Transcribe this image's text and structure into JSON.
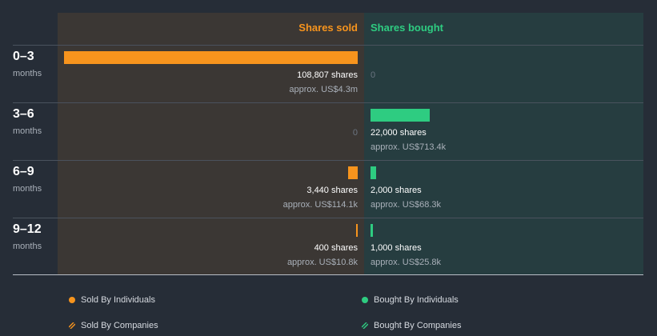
{
  "chart_data": {
    "type": "bar",
    "orientation": "horizontal",
    "columns": [
      "Shares sold",
      "Shares bought"
    ],
    "categories": [
      {
        "label": "0–3",
        "unit": "months"
      },
      {
        "label": "3–6",
        "unit": "months"
      },
      {
        "label": "6–9",
        "unit": "months"
      },
      {
        "label": "9–12",
        "unit": "months"
      }
    ],
    "series": [
      {
        "name": "Shares sold",
        "color": "#f7941d",
        "values": [
          108807,
          0,
          3440,
          400
        ],
        "share_labels": [
          "108,807 shares",
          "0",
          "3,440 shares",
          "400 shares"
        ],
        "approx_labels": [
          "approx. US$4.3m",
          "",
          "approx. US$114.1k",
          "approx. US$10.8k"
        ]
      },
      {
        "name": "Shares bought",
        "color": "#2ecc81",
        "values": [
          0,
          22000,
          2000,
          1000
        ],
        "share_labels": [
          "0",
          "22,000 shares",
          "2,000 shares",
          "1,000 shares"
        ],
        "approx_labels": [
          "",
          "approx. US$713.4k",
          "approx. US$68.3k",
          "approx. US$25.8k"
        ]
      }
    ],
    "legend": [
      {
        "label": "Sold By Individuals",
        "marker": "dot",
        "color": "#f7941d"
      },
      {
        "label": "Bought By Individuals",
        "marker": "dot",
        "color": "#2ecc81"
      },
      {
        "label": "Sold By Companies",
        "marker": "hatch",
        "color": "#f7941d"
      },
      {
        "label": "Bought By Companies",
        "marker": "hatch",
        "color": "#2ecc81"
      }
    ],
    "legend_position": "bottom",
    "max_value": 108807
  }
}
